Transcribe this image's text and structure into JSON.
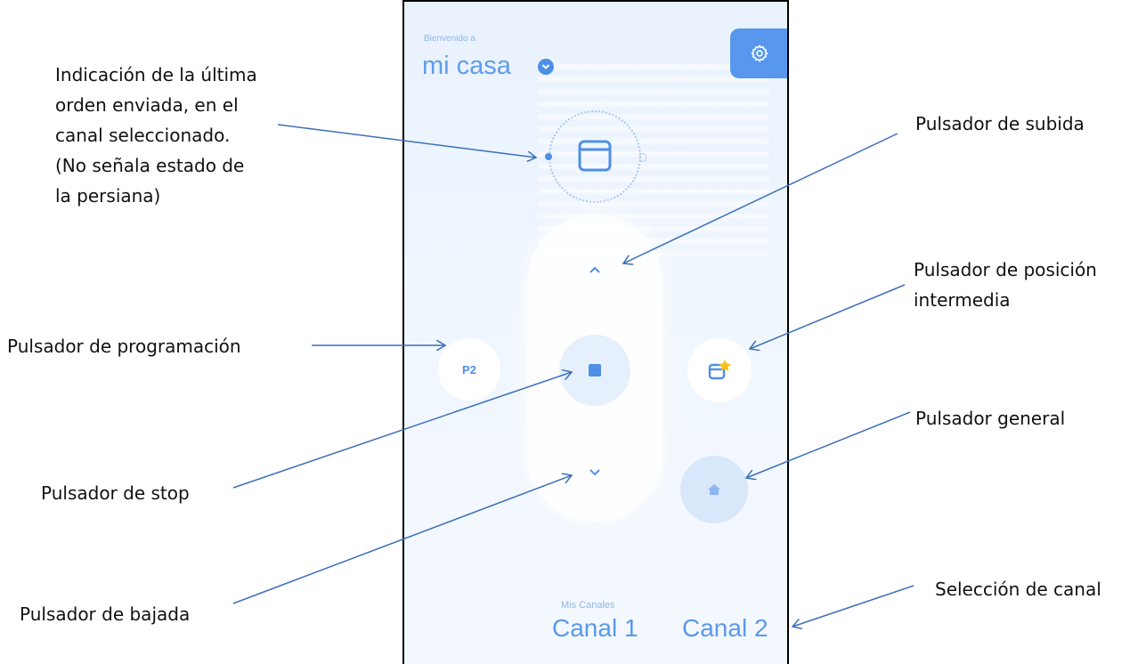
{
  "phone": {
    "welcome": "Bienvenido a",
    "home_name": "mi casa",
    "p2_label": "P2",
    "channels_title": "Mis Canales",
    "channels": [
      "Canal 1",
      "Canal 2"
    ],
    "icons": {
      "home_selector": "chevron-down-icon",
      "settings": "gear-icon",
      "last_order": "window-icon",
      "up": "chevron-up-icon",
      "down": "chevron-down-icon",
      "stop": "stop-icon",
      "favourite": "window-star-icon",
      "general": "home-icon"
    },
    "colors": {
      "accent": "#4f8fe6",
      "background": "#eef5fd",
      "annotation_line": "#3d6fb8"
    }
  },
  "annotations": {
    "last_order": "Indicación de la última\norden enviada, en el\ncanal seleccionado.\n(No señala estado de\nla persiana)",
    "up": "Pulsador de subida",
    "intermediate": "Pulsador de posición\nintermedia",
    "programming": "Pulsador de programación",
    "general": "Pulsador general",
    "stop": "Pulsador de stop",
    "down": "Pulsador de bajada",
    "channel": "Selección de canal"
  }
}
